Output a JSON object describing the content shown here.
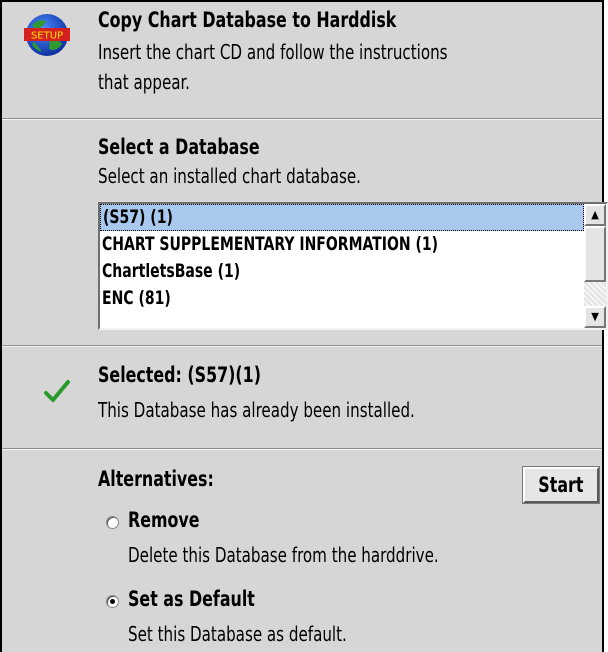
{
  "copy": {
    "title": "Copy Chart Database to Harddisk",
    "line1": "Insert the chart CD and follow the instructions",
    "line2": "that appear.",
    "icon_text": "SETUP"
  },
  "select": {
    "title": "Select a Database",
    "subtitle": "Select an installed chart database.",
    "items": [
      {
        "label": "(S57) (1)",
        "selected": true
      },
      {
        "label": "CHART SUPPLEMENTARY INFORMATION (1)",
        "selected": false
      },
      {
        "label": "ChartletsBase (1)",
        "selected": false
      },
      {
        "label": "ENC (81)",
        "selected": false
      }
    ],
    "scroll_up": "▲",
    "scroll_down": "▼"
  },
  "selected": {
    "title": "Selected: (S57)(1)",
    "message": "This Database has already been installed."
  },
  "alternatives": {
    "title": "Alternatives:",
    "start_label": "Start",
    "options": [
      {
        "label": "Remove",
        "description": "Delete this Database from the harddrive.",
        "checked": false
      },
      {
        "label": "Set as Default",
        "description": "Set this Database as default.",
        "checked": true
      }
    ]
  },
  "colors": {
    "panel": "#d6d6d6",
    "selection": "#a8c8ee",
    "check": "#2a9a2a",
    "icon_badge": "#d42020"
  }
}
